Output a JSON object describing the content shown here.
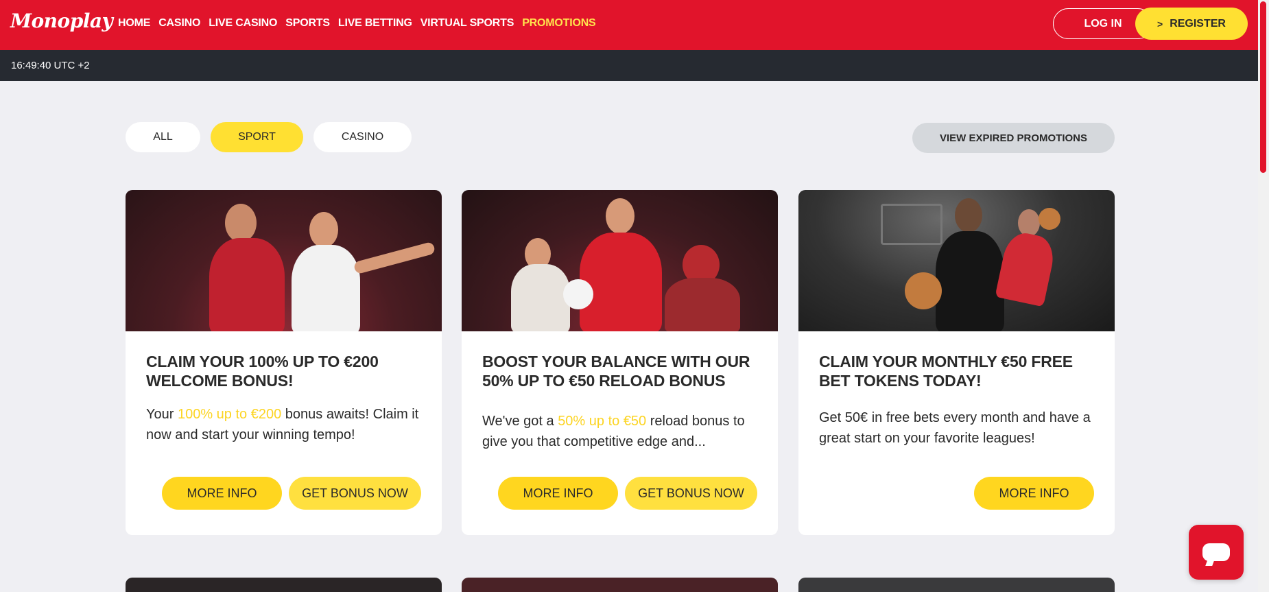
{
  "brand": {
    "logo": "Monoplay",
    "accent": "#e1142b",
    "yellow": "#ffe032"
  },
  "nav": {
    "items": [
      {
        "label": "HOME",
        "active": false
      },
      {
        "label": "CASINO",
        "active": false
      },
      {
        "label": "LIVE CASINO",
        "active": false
      },
      {
        "label": "SPORTS",
        "active": false
      },
      {
        "label": "LIVE BETTING",
        "active": false
      },
      {
        "label": "VIRTUAL SPORTS",
        "active": false
      },
      {
        "label": "PROMOTIONS",
        "active": true
      }
    ],
    "login_label": "LOG IN",
    "register_label": "REGISTER",
    "register_icon": "chevron-right-icon"
  },
  "timebar": {
    "time": "16:49:40 UTC +2"
  },
  "filters": {
    "all": "ALL",
    "sport": "SPORT",
    "casino": "CASINO",
    "selected": "SPORT",
    "expired_label": "VIEW EXPIRED PROMOTIONS"
  },
  "cards": [
    {
      "title": "CLAIM YOUR 100% UP TO €200 WELCOME BONUS!",
      "text_pre": "Your ",
      "text_hl": "100% up to €200",
      "text_post": " bonus awaits! Claim it now and start your winning tempo!",
      "more_label": "MORE INFO",
      "bonus_label": "GET BONUS NOW"
    },
    {
      "title": "BOOST YOUR BALANCE WITH OUR 50% UP TO €50 RELOAD BONUS",
      "text_pre": "We've got a ",
      "text_hl": "50% up to €50",
      "text_post": " reload bonus to give you that competitive edge and...",
      "more_label": "MORE INFO",
      "bonus_label": "GET BONUS NOW"
    },
    {
      "title": "CLAIM YOUR MONTHLY €50 FREE BET TOKENS TODAY!",
      "text": "Get 50€ in free bets every month and have a great start on your favorite leagues!",
      "more_label": "MORE INFO"
    }
  ],
  "chat": {
    "icon": "chat-icon"
  }
}
